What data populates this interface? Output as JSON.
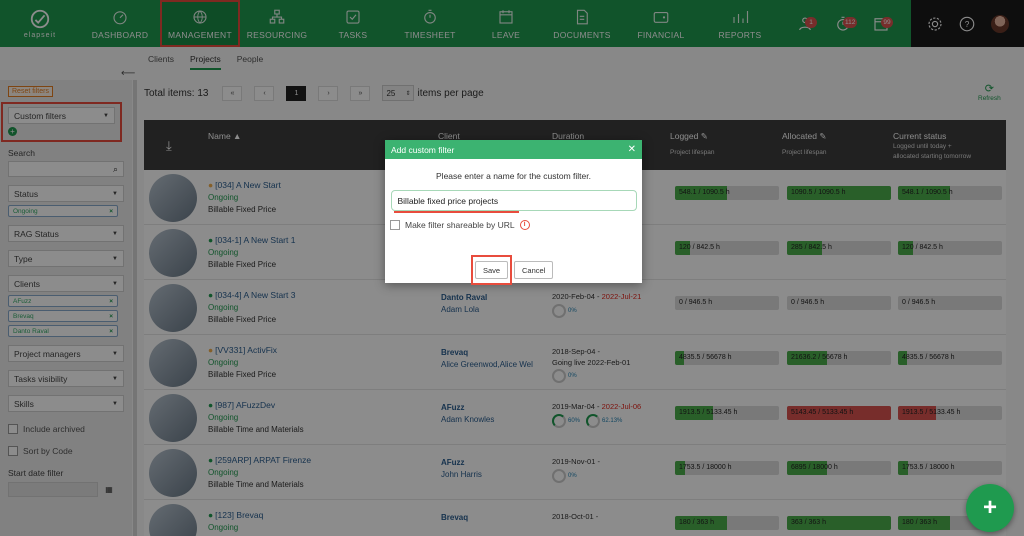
{
  "brand": {
    "name": "elapseit",
    "accent": "#1f9a4f"
  },
  "nav": {
    "items": [
      {
        "label": "DASHBOARD",
        "icon": "dashboard-icon"
      },
      {
        "label": "MANAGEMENT",
        "icon": "globe-icon",
        "active": true
      },
      {
        "label": "RESOURCING",
        "icon": "org-chart-icon"
      },
      {
        "label": "TASKS",
        "icon": "tasks-icon"
      },
      {
        "label": "TIMESHEET",
        "icon": "stopwatch-icon"
      },
      {
        "label": "LEAVE",
        "icon": "calendar-icon"
      },
      {
        "label": "DOCUMENTS",
        "icon": "document-icon"
      },
      {
        "label": "FINANCIAL",
        "icon": "wallet-icon"
      },
      {
        "label": "REPORTS",
        "icon": "chart-icon"
      }
    ],
    "badges": [
      "1",
      "112",
      "99"
    ]
  },
  "subtabs": [
    "Clients",
    "Projects",
    "People"
  ],
  "sidebar": {
    "reset_label": "Reset filters",
    "custom_filters": "Custom filters",
    "search_label": "Search",
    "status_label": "Status",
    "status_tag": "Ongoing",
    "rag_label": "RAG Status",
    "type_label": "Type",
    "clients_label": "Clients",
    "client_tags": [
      "AFuzz",
      "Brevaq",
      "Danto Raval"
    ],
    "pm_label": "Project managers",
    "tasks_vis_label": "Tasks visibility",
    "skills_label": "Skills",
    "include_archived": "Include archived",
    "sort_by_code": "Sort by Code",
    "start_date_label": "Start date filter"
  },
  "toolbar": {
    "total_items": "Total items: 13",
    "page_first": "«",
    "page_prev": "‹",
    "page_current": "1",
    "page_next": "›",
    "page_last": "»",
    "per_page_value": "25",
    "per_page_label": "items per page",
    "refresh_label": "Refresh"
  },
  "table": {
    "headers": {
      "name": "Name ▲",
      "client": "Client",
      "duration": "Duration",
      "logged": "Logged",
      "logged_sub": "Project lifespan",
      "allocated": "Allocated",
      "allocated_sub": "Project lifespan",
      "status": "Current status",
      "status_sub1": "Logged until today +",
      "status_sub2": "allocated starting tomorrow"
    },
    "rows": [
      {
        "name": "[034] A New Start",
        "status": "Ongoing",
        "type": "Billable Fixed Price",
        "client": "",
        "manager": "",
        "dur_start": "",
        "dur_end": "",
        "dur2": "",
        "ring1": "",
        "ring2": "",
        "logged": "548.1 / 1090.5 h",
        "logged_pct": 0.5,
        "allocated": "1090.5 / 1090.5 h",
        "alloc_pct": 1.0,
        "current": "548.1 / 1090.5 h",
        "cur_pct": 0.5,
        "alloc_red": false,
        "cur_red": false,
        "dot": "orange"
      },
      {
        "name": "[034-1] A New Start 1",
        "status": "Ongoing",
        "type": "Billable Fixed Price",
        "client": "",
        "manager": "",
        "dur_start": "",
        "dur_end": "",
        "dur2": "",
        "ring1": "",
        "ring2": "",
        "logged": "120 / 842.5 h",
        "logged_pct": 0.14,
        "allocated": "285 / 842.5 h",
        "alloc_pct": 0.34,
        "current": "120 / 842.5 h",
        "cur_pct": 0.14,
        "alloc_red": false,
        "cur_red": false,
        "dot": "green"
      },
      {
        "name": "[034-4] A New Start 3",
        "status": "Ongoing",
        "type": "Billable Fixed Price",
        "client": "Danto Raval",
        "manager": "Adam Lola",
        "dur_start": "2020-Feb-04 - ",
        "dur_end": "2022-Jul-21",
        "dur2": "",
        "ring1": "0%",
        "ring2": "",
        "logged": "0 / 946.5 h",
        "logged_pct": 0,
        "allocated": "0 / 946.5 h",
        "alloc_pct": 0,
        "current": "0 / 946.5 h",
        "cur_pct": 0,
        "alloc_red": false,
        "cur_red": false,
        "dot": "green"
      },
      {
        "name": "[VV331] ActivFix",
        "status": "Ongoing",
        "type": "Billable Fixed Price",
        "client": "Brevaq",
        "manager": "Alice Greenwod,Alice Wel",
        "dur_start": "2018-Sep-04 - ",
        "dur_end": "",
        "dur2": "Going live 2022-Feb-01",
        "ring1": "0%",
        "ring2": "",
        "logged": "4835.5 / 56678 h",
        "logged_pct": 0.09,
        "allocated": "21636.2 / 56678 h",
        "alloc_pct": 0.38,
        "current": "4835.5 / 56678 h",
        "cur_pct": 0.09,
        "alloc_red": false,
        "cur_red": false,
        "dot": "orange"
      },
      {
        "name": "[987] AFuzzDev",
        "status": "Ongoing",
        "type": "Billable Time and Materials",
        "client": "AFuzz",
        "manager": "Adam Knowles",
        "dur_start": "2019-Mar-04 - ",
        "dur_end": "2022-Jul-06",
        "dur2": "",
        "ring1": "60%",
        "ring2": "62.13%",
        "logged": "1913.5 / 5133.45 h",
        "logged_pct": 0.37,
        "allocated": "5143.45 / 5133.45 h",
        "alloc_pct": 1.0,
        "current": "1913.5 / 5133.45 h",
        "cur_pct": 0.37,
        "alloc_red": true,
        "cur_red": true,
        "dot": "green"
      },
      {
        "name": "[259ARP] ARPAT Firenze",
        "status": "Ongoing",
        "type": "Billable Time and Materials",
        "client": "AFuzz",
        "manager": "John Harris",
        "dur_start": "2019-Nov-01 - ",
        "dur_end": "",
        "dur2": "",
        "ring1": "0%",
        "ring2": "",
        "logged": "1753.5 / 18000 h",
        "logged_pct": 0.1,
        "allocated": "6895 / 18000 h",
        "alloc_pct": 0.38,
        "current": "1753.5 / 18000 h",
        "cur_pct": 0.1,
        "alloc_red": false,
        "cur_red": false,
        "dot": "green"
      },
      {
        "name": "[123] Brevaq",
        "status": "Ongoing",
        "type": "",
        "client": "Brevaq",
        "manager": "",
        "dur_start": "2018-Oct-01 - ",
        "dur_end": "",
        "dur2": "",
        "ring1": "",
        "ring2": "",
        "logged": "180 / 363 h",
        "logged_pct": 0.5,
        "allocated": "363 / 363 h",
        "alloc_pct": 1.0,
        "current": "180 / 363 h",
        "cur_pct": 0.5,
        "alloc_red": false,
        "cur_red": false,
        "dot": "green"
      }
    ]
  },
  "modal": {
    "title": "Add custom filter",
    "prompt": "Please enter a name for the custom filter.",
    "input_value": "Billable fixed price projects",
    "share_label": "Make filter shareable by URL",
    "save_label": "Save",
    "cancel_label": "Cancel"
  }
}
